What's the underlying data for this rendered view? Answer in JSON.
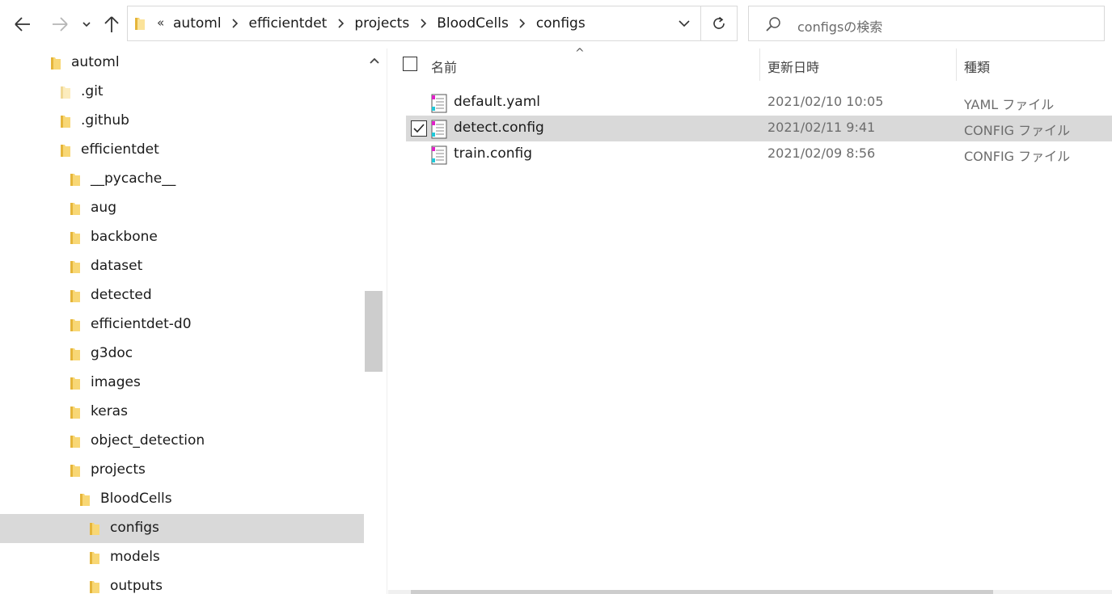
{
  "toolbar": {
    "back_icon": "arrow-left-icon",
    "forward_icon": "arrow-right-icon",
    "recent_icon": "chevron-down-icon",
    "up_icon": "arrow-up-icon"
  },
  "address_bar": {
    "overflow": "«",
    "breadcrumbs": [
      "automl",
      "efficientdet",
      "projects",
      "BloodCells",
      "configs"
    ],
    "separator_icon": "chevron-right-icon",
    "dropdown_icon": "chevron-down-icon",
    "refresh_icon": "refresh-icon"
  },
  "search": {
    "placeholder": "configsの検索",
    "icon": "search-icon"
  },
  "nav_tree": {
    "items": [
      {
        "label": "automl",
        "indent": 0
      },
      {
        "label": ".git",
        "indent": 1,
        "faded": true
      },
      {
        "label": ".github",
        "indent": 1
      },
      {
        "label": "efficientdet",
        "indent": 1
      },
      {
        "label": "__pycache__",
        "indent": 2
      },
      {
        "label": "aug",
        "indent": 2
      },
      {
        "label": "backbone",
        "indent": 2
      },
      {
        "label": "dataset",
        "indent": 2
      },
      {
        "label": "detected",
        "indent": 2
      },
      {
        "label": "efficientdet-d0",
        "indent": 2
      },
      {
        "label": "g3doc",
        "indent": 2
      },
      {
        "label": "images",
        "indent": 2
      },
      {
        "label": "keras",
        "indent": 2
      },
      {
        "label": "object_detection",
        "indent": 2
      },
      {
        "label": "projects",
        "indent": 2
      },
      {
        "label": "BloodCells",
        "indent": 3
      },
      {
        "label": "configs",
        "indent": 4,
        "selected": true
      },
      {
        "label": "models",
        "indent": 4
      },
      {
        "label": "outputs",
        "indent": 4
      }
    ]
  },
  "file_list": {
    "columns": {
      "name": "名前",
      "modified": "更新日時",
      "type": "種類"
    },
    "sort_indicator": "^",
    "rows": [
      {
        "name": "default.yaml",
        "modified": "2021/02/10 10:05",
        "type": "YAML ファイル",
        "checked": false,
        "selected": false
      },
      {
        "name": "detect.config",
        "modified": "2021/02/11 9:41",
        "type": "CONFIG ファイル",
        "checked": true,
        "selected": true
      },
      {
        "name": "train.config",
        "modified": "2021/02/09 8:56",
        "type": "CONFIG ファイル",
        "checked": false,
        "selected": false
      }
    ]
  },
  "colors": {
    "selection": "#d9d9d9",
    "folder": "#f8d775",
    "folder_dark": "#e5b53a"
  }
}
